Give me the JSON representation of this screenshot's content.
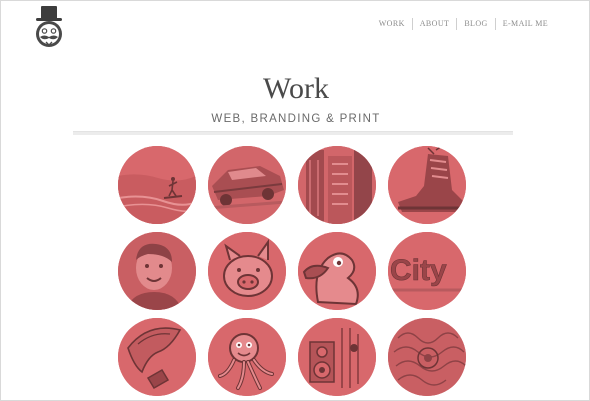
{
  "header": {
    "logo_icon": "top-hat-mustache-mascot-icon",
    "nav": [
      {
        "label": "WORK"
      },
      {
        "label": "ABOUT"
      },
      {
        "label": "BLOG"
      },
      {
        "label": "E-MAIL ME"
      }
    ]
  },
  "page": {
    "title": "Work",
    "subtitle": "WEB, BRANDING & PRINT"
  },
  "portfolio": {
    "tint_color": "#d8686c",
    "items": [
      {
        "icon": "surfer-icon"
      },
      {
        "icon": "classic-car-icon"
      },
      {
        "icon": "building-icon"
      },
      {
        "icon": "boot-icon"
      },
      {
        "icon": "boy-portrait-icon"
      },
      {
        "icon": "cartoon-pig-icon"
      },
      {
        "icon": "cartoon-duck-icon"
      },
      {
        "icon": "city-logo-icon",
        "text": "City"
      },
      {
        "icon": "hand-sketch-icon"
      },
      {
        "icon": "cartoon-monster-icon"
      },
      {
        "icon": "speaker-poster-icon"
      },
      {
        "icon": "ornate-pattern-icon"
      }
    ]
  }
}
